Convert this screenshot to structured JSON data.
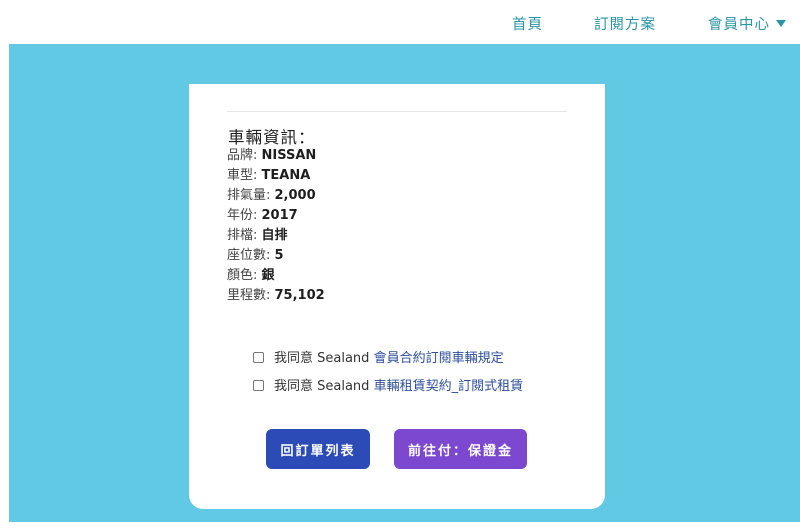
{
  "nav": {
    "home": "首頁",
    "plans": "訂閱方案",
    "member": "會員中心"
  },
  "vehicle": {
    "title": "車輛資訊：",
    "rows": [
      {
        "label": "品牌: ",
        "value": "NISSAN"
      },
      {
        "label": "車型: ",
        "value": "TEANA"
      },
      {
        "label": "排氣量: ",
        "value": "2,000"
      },
      {
        "label": "年份: ",
        "value": "2017"
      },
      {
        "label": "排檔: ",
        "value": "自排"
      },
      {
        "label": "座位數: ",
        "value": "5"
      },
      {
        "label": "顏色: ",
        "value": "銀"
      },
      {
        "label": "里程數: ",
        "value": "75,102"
      }
    ]
  },
  "agreements": [
    {
      "prefix": "我同意 Sealand ",
      "link": "會員合約訂閱車輛規定",
      "checked": false
    },
    {
      "prefix": "我同意 Sealand ",
      "link": "車輛租賃契約_訂閱式租賃",
      "checked": false
    }
  ],
  "buttons": {
    "back": "回訂單列表",
    "pay": "前往付：保證金"
  },
  "colors": {
    "nav_text": "#2a95a4",
    "background_panel": "#62c9e5",
    "link": "#2e4f9c",
    "back_button": "#2c4bb6",
    "pay_button": "#7c48cf"
  }
}
